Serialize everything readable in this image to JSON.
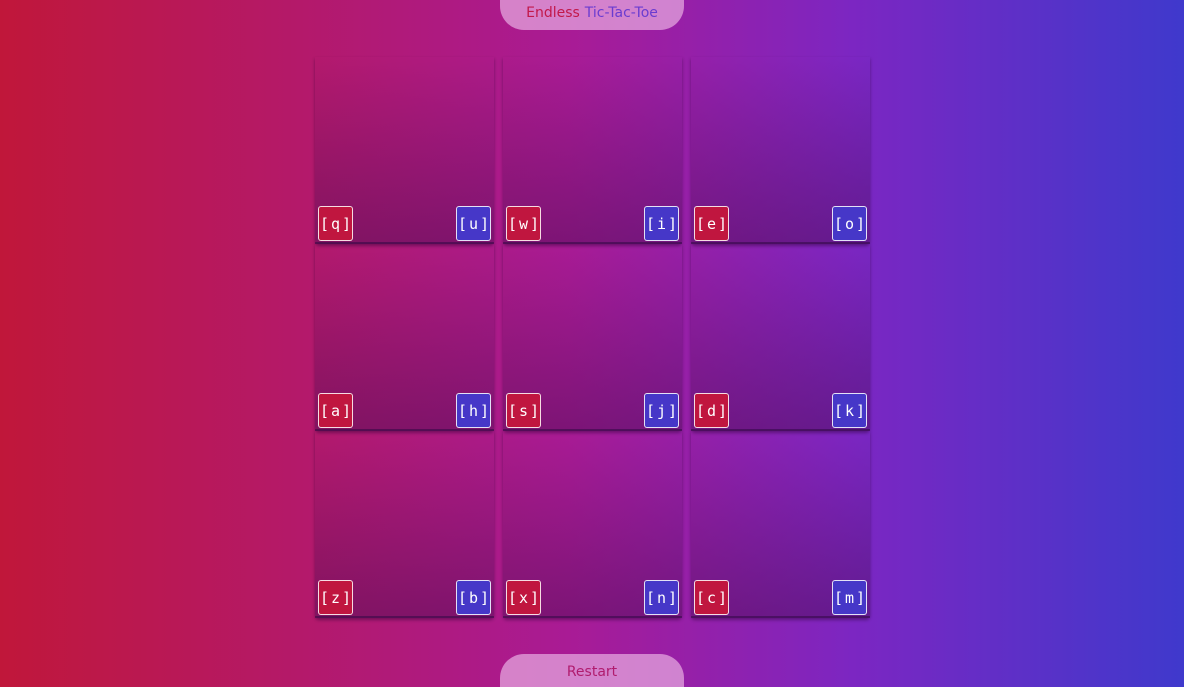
{
  "header": {
    "title_part1": "Endless",
    "title_part2": "Tic-Tac-Toe"
  },
  "board": {
    "cells": [
      {
        "p1_key": "[q]",
        "p2_key": "[u]"
      },
      {
        "p1_key": "[w]",
        "p2_key": "[i]"
      },
      {
        "p1_key": "[e]",
        "p2_key": "[o]"
      },
      {
        "p1_key": "[a]",
        "p2_key": "[h]"
      },
      {
        "p1_key": "[s]",
        "p2_key": "[j]"
      },
      {
        "p1_key": "[d]",
        "p2_key": "[k]"
      },
      {
        "p1_key": "[z]",
        "p2_key": "[b]"
      },
      {
        "p1_key": "[x]",
        "p2_key": "[n]"
      },
      {
        "p1_key": "[c]",
        "p2_key": "[m]"
      }
    ]
  },
  "footer": {
    "restart_label": "Restart"
  },
  "colors": {
    "player1": "#c0163f",
    "player2": "#4637c8"
  }
}
